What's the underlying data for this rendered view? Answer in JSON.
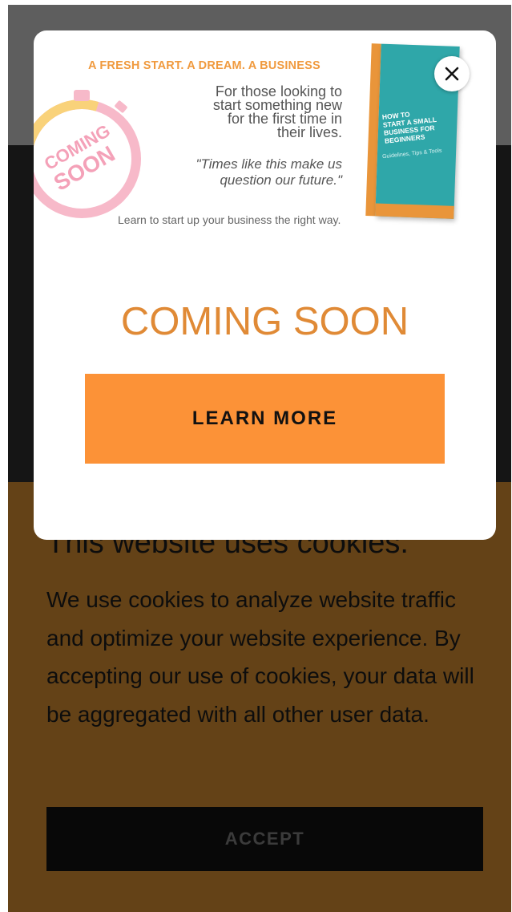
{
  "page": {
    "colors": {
      "accent": "#fc9237",
      "heading": "#e08a36",
      "cookie_bg": "#c9842f",
      "backdrop": "rgba(0,0,0,0.5)"
    }
  },
  "popup": {
    "banner": {
      "tagline": "A FRESH START. A DREAM. A BUSINESS",
      "lines": [
        "For those looking to",
        "start something new",
        "for the first time in",
        "their lives."
      ],
      "quote_lines": [
        "\"Times like this make us",
        "question our future.\""
      ],
      "learn_line": "Learn to start up your business the right way.",
      "stopwatch_text": [
        "COMING",
        "SOON"
      ],
      "book": {
        "title_lines": [
          "HOW TO",
          "START A SMALL",
          "BUSINESS FOR",
          "BEGINNERS"
        ],
        "subtitle": "Guidelines, Tips & Tools"
      }
    },
    "close_icon": "close-icon",
    "heading": "COMING SOON",
    "cta_label": "LEARN MORE"
  },
  "cookie": {
    "title": "This website uses cookies.",
    "text": "We use cookies to analyze website traffic and optimize your website experience. By accepting our use of cookies, your data will be aggregated with all other user data.",
    "accept_label": "ACCEPT"
  }
}
